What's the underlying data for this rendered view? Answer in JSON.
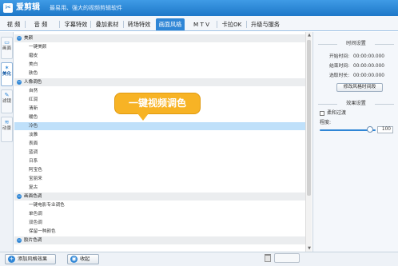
{
  "app": {
    "logo_icon": "scissors-logo-icon",
    "name": "爱剪辑",
    "slogan": "最易用、强大的视频剪辑软件"
  },
  "menu": {
    "tabs": [
      "视 频",
      "音 频",
      "字幕特效",
      "叠加素材",
      "转场特效",
      "画面风格",
      "M T V",
      "卡拉OK",
      "升级与服务"
    ],
    "active": "画面风格"
  },
  "sidebar": {
    "tabs": [
      {
        "label": "画面",
        "icon": "picture-icon"
      },
      {
        "label": "美化",
        "icon": "magic-wand-icon"
      },
      {
        "label": "滤镜",
        "icon": "filter-icon"
      },
      {
        "label": "动景",
        "icon": "motion-icon"
      }
    ],
    "active": "美化"
  },
  "list": {
    "rows": [
      {
        "type": "category",
        "text": "美颜"
      },
      {
        "type": "item",
        "text": "一键美颜"
      },
      {
        "type": "item",
        "text": "磨皮"
      },
      {
        "type": "item",
        "text": "美白"
      },
      {
        "type": "item",
        "text": "肤色"
      },
      {
        "type": "category",
        "text": "人像调色"
      },
      {
        "type": "item",
        "text": "自然"
      },
      {
        "type": "item",
        "text": "红润"
      },
      {
        "type": "item",
        "text": "清新"
      },
      {
        "type": "item",
        "text": "暖色"
      },
      {
        "type": "item",
        "text": "冷色",
        "selected": true
      },
      {
        "type": "item",
        "text": "淡雅"
      },
      {
        "type": "item",
        "text": "表面"
      },
      {
        "type": "item",
        "text": "蓝调"
      },
      {
        "type": "item",
        "text": "日系"
      },
      {
        "type": "item",
        "text": "阿宝色"
      },
      {
        "type": "item",
        "text": "宝丽来"
      },
      {
        "type": "item",
        "text": "复古"
      },
      {
        "type": "category",
        "text": "画面色调"
      },
      {
        "type": "item",
        "text": "一键电影专业调色"
      },
      {
        "type": "item",
        "text": "单色调"
      },
      {
        "type": "item",
        "text": "双色调"
      },
      {
        "type": "item",
        "text": "保留一种颜色"
      },
      {
        "type": "category",
        "text": "胶片色调"
      }
    ]
  },
  "callout": {
    "text": "一键视频调色"
  },
  "time_settings": {
    "title": "时间设置",
    "fields": [
      {
        "label": "开始时间:",
        "value": "00:00:00.000"
      },
      {
        "label": "结束时间:",
        "value": "00:00:00.000"
      },
      {
        "label": "选取时长:",
        "value": "00:00:00.000"
      }
    ],
    "button": "修改风格时间段"
  },
  "effect_settings": {
    "title": "效果设置",
    "checkbox_label": "柔和过渡",
    "checkbox_checked": false,
    "degree_label": "程度:",
    "degree_value": "100"
  },
  "bottom": {
    "add_style_button": "添加风格效果",
    "favorite_button": "收起"
  },
  "colors": {
    "accent": "#2f86d6",
    "callout": "#f7b325",
    "selected_row": "#bfe0fa"
  }
}
